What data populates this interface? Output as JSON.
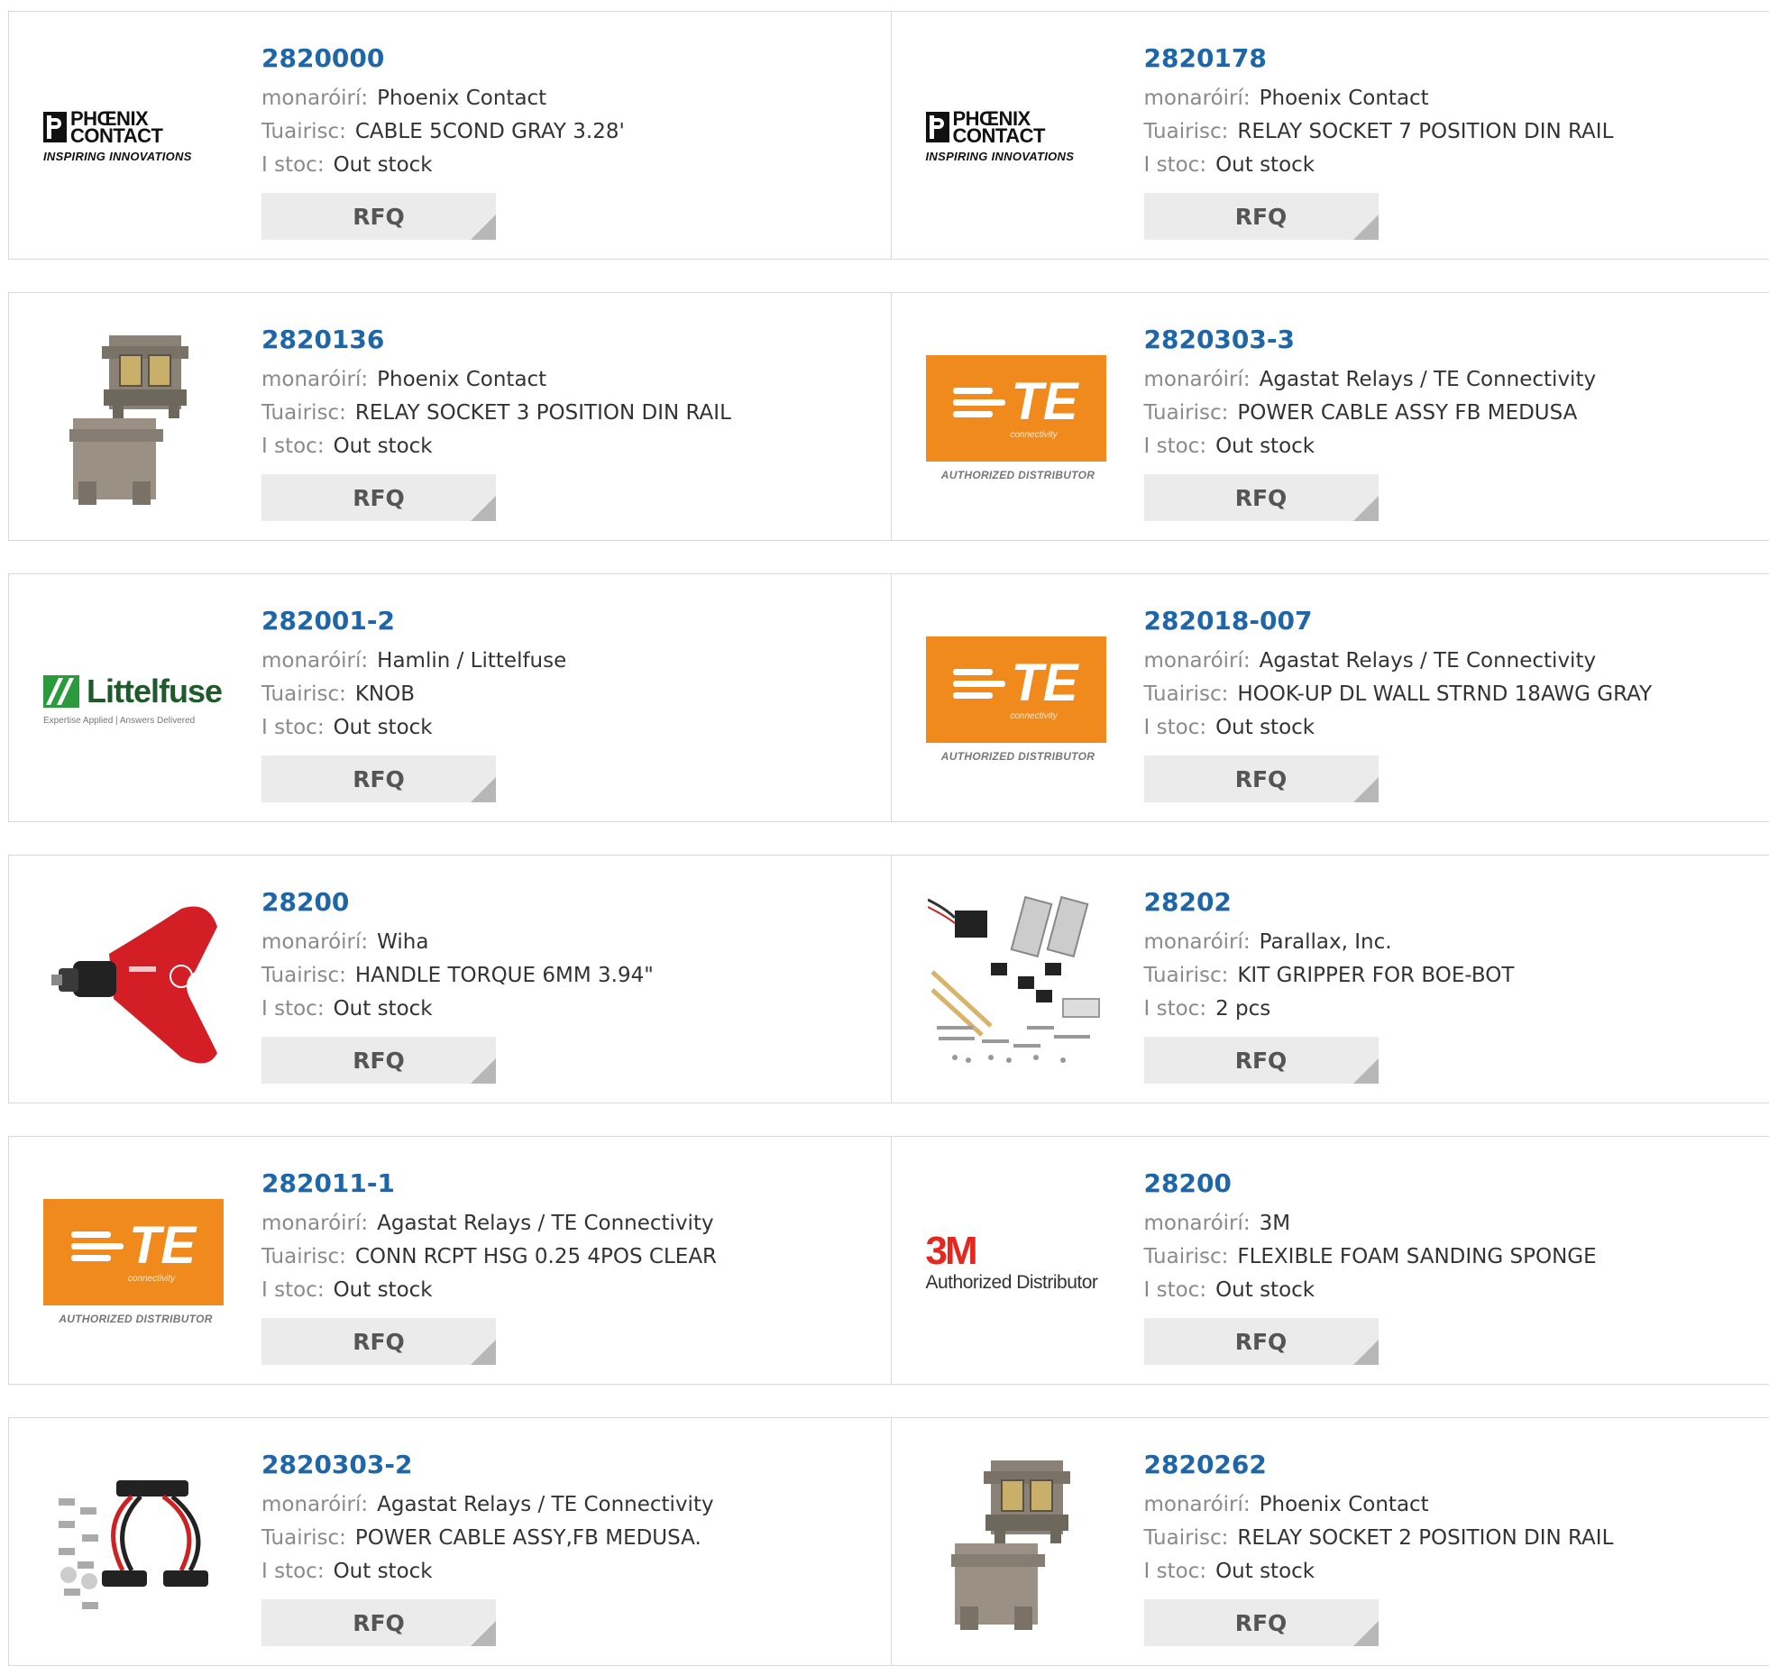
{
  "labels": {
    "manufacturer": "monaróirí:",
    "description": "Tuairisc:",
    "stock": "I stoc:",
    "rfq": "RFQ"
  },
  "logo_text": {
    "phoenix_line1": "PHŒNIX",
    "phoenix_line2": "CONTACT",
    "phoenix_tagline": "INSPIRING INNOVATIONS",
    "te_letters": "TE",
    "te_sub": "connectivity",
    "te_authorized": "AUTHORIZED DISTRIBUTOR",
    "littelfuse_word": "Littelfuse",
    "littelfuse_tagline": "Expertise Applied | Answers Delivered",
    "m3_word": "3M",
    "m3_authorized": "Authorized Distributor"
  },
  "products": [
    {
      "part_number": "2820000",
      "manufacturer": "Phoenix Contact",
      "description": "CABLE 5COND GRAY 3.28'",
      "stock": "Out stock",
      "thumb": "phoenix-logo"
    },
    {
      "part_number": "2820178",
      "manufacturer": "Phoenix Contact",
      "description": "RELAY SOCKET 7 POSITION DIN RAIL",
      "stock": "Out stock",
      "thumb": "phoenix-logo"
    },
    {
      "part_number": "2820136",
      "manufacturer": "Phoenix Contact",
      "description": "RELAY SOCKET 3 POSITION DIN RAIL",
      "stock": "Out stock",
      "thumb": "relay-socket-photo"
    },
    {
      "part_number": "2820303-3",
      "manufacturer": "Agastat Relays / TE Connectivity",
      "description": "POWER CABLE ASSY FB MEDUSA",
      "stock": "Out stock",
      "thumb": "te-logo"
    },
    {
      "part_number": "282001-2",
      "manufacturer": "Hamlin / Littelfuse",
      "description": "KNOB",
      "stock": "Out stock",
      "thumb": "littelfuse-logo"
    },
    {
      "part_number": "282018-007",
      "manufacturer": "Agastat Relays / TE Connectivity",
      "description": "HOOK-UP DL WALL STRND 18AWG GRAY",
      "stock": "Out stock",
      "thumb": "te-logo"
    },
    {
      "part_number": "28200",
      "manufacturer": "Wiha",
      "description": "HANDLE TORQUE 6MM 3.94\"",
      "stock": "Out stock",
      "thumb": "torque-handle-photo"
    },
    {
      "part_number": "28202",
      "manufacturer": "Parallax, Inc.",
      "description": "KIT GRIPPER FOR BOE-BOT",
      "stock": "2 pcs",
      "thumb": "gripper-kit-photo"
    },
    {
      "part_number": "282011-1",
      "manufacturer": "Agastat Relays / TE Connectivity",
      "description": "CONN RCPT HSG 0.25 4POS CLEAR",
      "stock": "Out stock",
      "thumb": "te-logo"
    },
    {
      "part_number": "28200",
      "manufacturer": "3M",
      "description": "FLEXIBLE FOAM SANDING SPONGE",
      "stock": "Out stock",
      "thumb": "3m-logo"
    },
    {
      "part_number": "2820303-2",
      "manufacturer": "Agastat Relays / TE Connectivity",
      "description": "POWER CABLE ASSY,FB MEDUSA.",
      "stock": "Out stock",
      "thumb": "power-cable-photo"
    },
    {
      "part_number": "2820262",
      "manufacturer": "Phoenix Contact",
      "description": "RELAY SOCKET 2 POSITION DIN RAIL",
      "stock": "Out stock",
      "thumb": "relay-socket-photo"
    }
  ]
}
